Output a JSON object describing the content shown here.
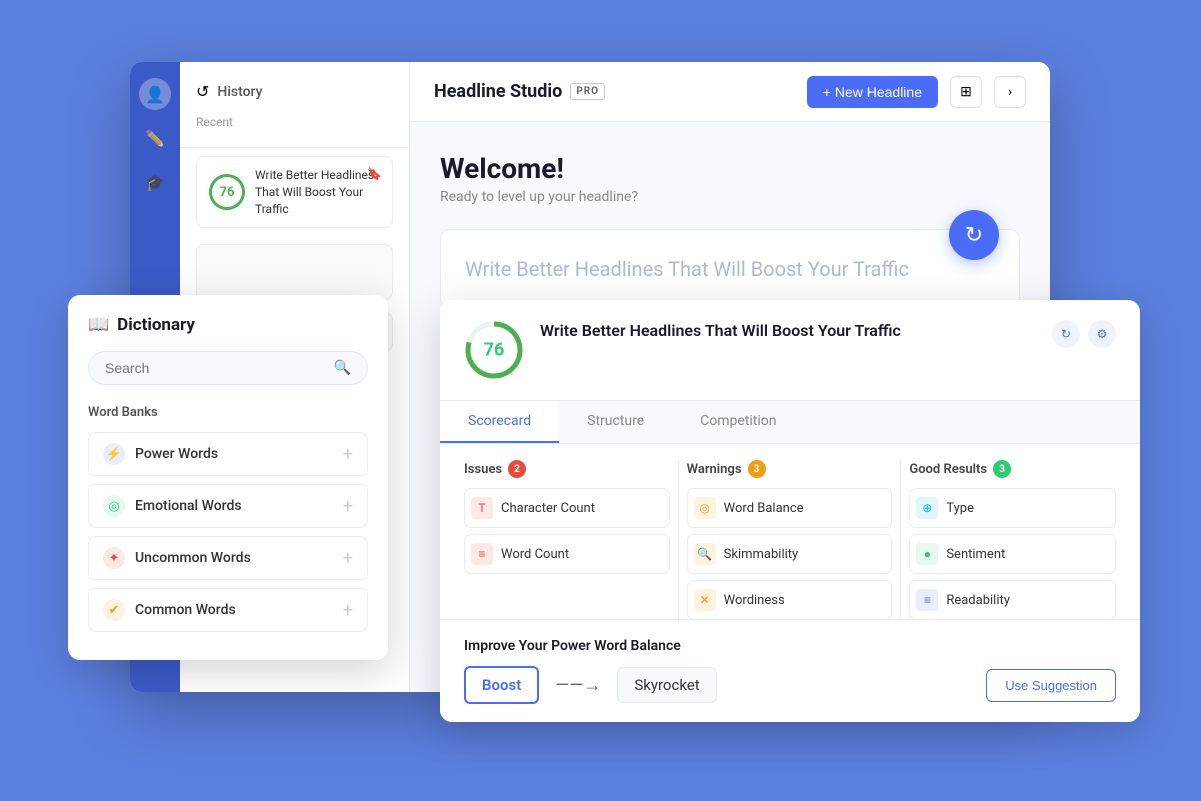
{
  "app": {
    "brand": "Headline Studio",
    "pro": "PRO",
    "new_headline_label": "+ New Headline"
  },
  "sidebar": {
    "icons": [
      "👤",
      "✏️",
      "🎓"
    ]
  },
  "history": {
    "title": "History",
    "recent_label": "Recent",
    "items": [
      {
        "score": "76",
        "text": "Write Better Headlines That Will Boost Your Traffic"
      }
    ]
  },
  "welcome": {
    "title": "Welcome!",
    "subtitle": "Ready to level up your headline?",
    "headline_placeholder": "Write Better Headlines That Will Boost Your Traffic"
  },
  "dictionary": {
    "title": "Dictionary",
    "search_placeholder": "Search",
    "word_banks_title": "Word Banks",
    "items": [
      {
        "id": "power",
        "label": "Power Words",
        "type": "power",
        "icon": "⚡"
      },
      {
        "id": "emotional",
        "label": "Emotional Words",
        "type": "emotional",
        "icon": "🔵"
      },
      {
        "id": "uncommon",
        "label": "Uncommon Words",
        "type": "uncommon",
        "icon": "⭐"
      },
      {
        "id": "common",
        "label": "Common Words",
        "type": "common",
        "icon": "✅"
      }
    ]
  },
  "analysis": {
    "score": "76",
    "headline": "Write Better Headlines That Will Boost Your Traffic",
    "tabs": [
      "Scorecard",
      "Structure",
      "Competition"
    ],
    "active_tab": "Scorecard",
    "columns": {
      "issues": {
        "label": "Issues",
        "count": "2",
        "items": [
          {
            "label": "Character Count",
            "icon_type": "red",
            "icon": "T"
          },
          {
            "label": "Word Count",
            "icon_type": "red",
            "icon": "≡"
          }
        ]
      },
      "warnings": {
        "label": "Warnings",
        "count": "3",
        "items": [
          {
            "label": "Word Balance",
            "icon_type": "orange",
            "icon": "◎"
          },
          {
            "label": "Skimmability",
            "icon_type": "orange",
            "icon": "🔍"
          },
          {
            "label": "Wordiness",
            "icon_type": "orange",
            "icon": "✕"
          }
        ]
      },
      "good": {
        "label": "Good Results",
        "count": "3",
        "items": [
          {
            "label": "Type",
            "icon_type": "teal",
            "icon": "⊕"
          },
          {
            "label": "Sentiment",
            "icon_type": "green",
            "icon": "●"
          },
          {
            "label": "Readability",
            "icon_type": "blue",
            "icon": "≡"
          }
        ]
      }
    },
    "suggestion": {
      "title": "Improve Your Power Word Balance",
      "original": "Boost",
      "replacement": "Skyrocket",
      "cta": "Use Suggestion"
    }
  }
}
